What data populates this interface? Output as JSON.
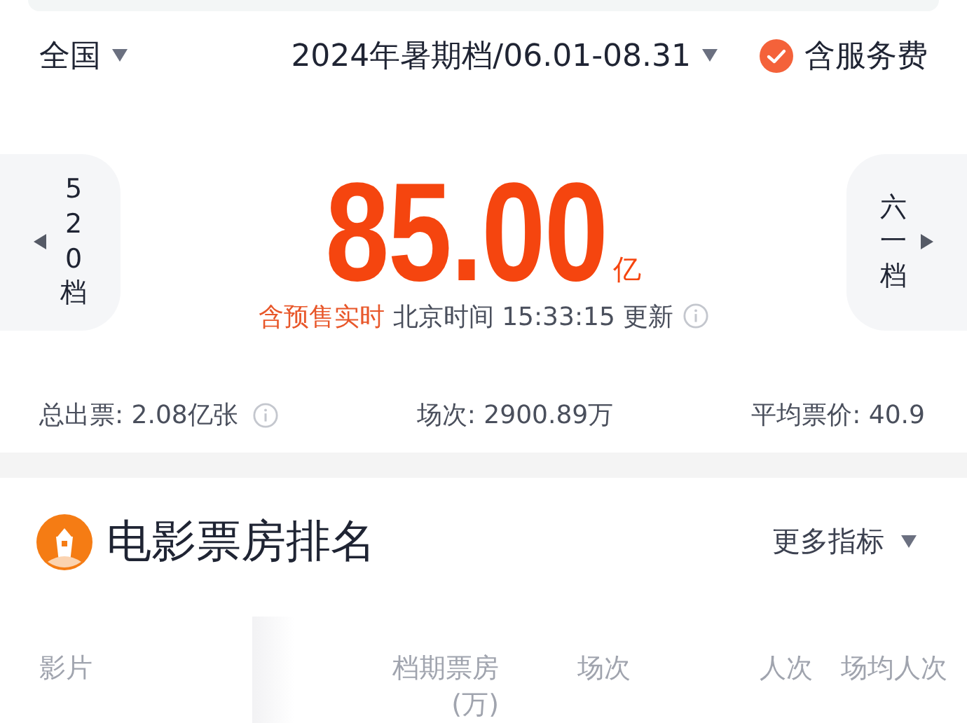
{
  "filters": {
    "region": "全国",
    "period": "2024年暑期档/06.01-08.31",
    "service_fee": {
      "label": "含服务费",
      "checked": true
    }
  },
  "hero": {
    "prev": "520档",
    "next": "六一档",
    "amount": "85.00",
    "unit": "亿",
    "note_highlight": "含预售实时",
    "note": "北京时间 15:33:15 更新"
  },
  "stats": [
    {
      "label": "总出票: 2.08亿张",
      "has_info": true
    },
    {
      "label": "场次: 2900.89万",
      "has_info": false
    },
    {
      "label": "平均票价: 40.9",
      "has_info": false
    }
  ],
  "ranking": {
    "title": "电影票房排名",
    "more": "更多指标",
    "columns": [
      "影片",
      "档期票房(万)",
      "场次",
      "人次",
      "场均人次"
    ]
  }
}
